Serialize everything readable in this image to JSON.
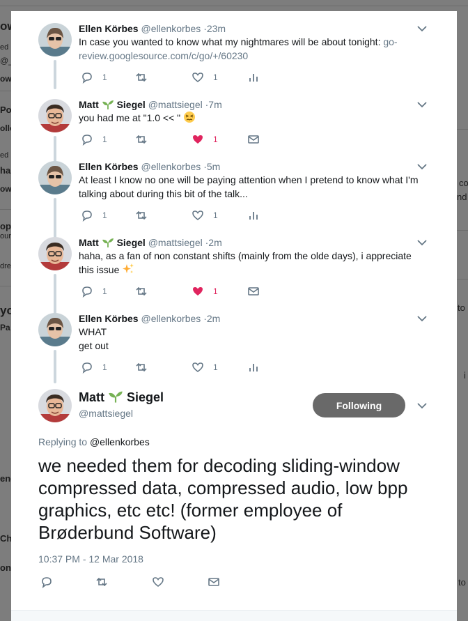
{
  "background": {
    "left_fragments": [
      "ow",
      "ed",
      "@_",
      "ow",
      "Po",
      "ollo",
      "ed",
      "har",
      "ow",
      "op",
      "our",
      "dre",
      "yo",
      "Pa",
      "ene",
      "Ch",
      "on"
    ],
    "right_fragments": [
      "co",
      "nd",
      "to",
      "i",
      "to"
    ]
  },
  "thread": [
    {
      "name": "Ellen Körbes",
      "handle": "@ellenkorbes",
      "time": "·23m",
      "text": "In case you wanted to know what my nightmares will be about tonight: ",
      "link": "go-review.googlesource.com/c/go/+/60230",
      "replies": "1",
      "likes": "1",
      "liked": false
    },
    {
      "name_first": "Matt",
      "name_last": "Siegel",
      "handle": "@mattsiegel",
      "time": "·7m",
      "text": "you had me at \"1.0 << \"",
      "replies": "1",
      "likes": "1",
      "liked": true
    },
    {
      "name": "Ellen Körbes",
      "handle": "@ellenkorbes",
      "time": "·5m",
      "text": "At least I know no one will be paying attention when I pretend to know what I'm talking about during this bit of the talk...",
      "replies": "1",
      "likes": "1",
      "liked": false
    },
    {
      "name_first": "Matt",
      "name_last": "Siegel",
      "handle": "@mattsiegel",
      "time": "·2m",
      "text": "haha, as a fan of non constant shifts (mainly from the olde days), i appreciate this issue",
      "replies": "1",
      "likes": "1",
      "liked": true
    },
    {
      "name": "Ellen Körbes",
      "handle": "@ellenkorbes",
      "time": "·2m",
      "text_line1": "WHAT",
      "text_line2": "get out",
      "replies": "1",
      "likes": "1",
      "liked": false
    }
  ],
  "main_tweet": {
    "name_first": "Matt",
    "name_last": "Siegel",
    "handle": "@mattsiegel",
    "follow_label": "Following",
    "replying_prefix": "Replying to ",
    "replying_to": "@ellenkorbes",
    "text": "we needed them for decoding sliding-window compressed data, compressed audio, low bpp graphics, etc etc! (former employee of Brøderbund Software)",
    "timestamp": "10:37 PM - 12 Mar 2018"
  },
  "colors": {
    "like_red": "#e0245e",
    "muted": "#657786",
    "follow_bg": "#696969",
    "sprout": "#77b255"
  }
}
